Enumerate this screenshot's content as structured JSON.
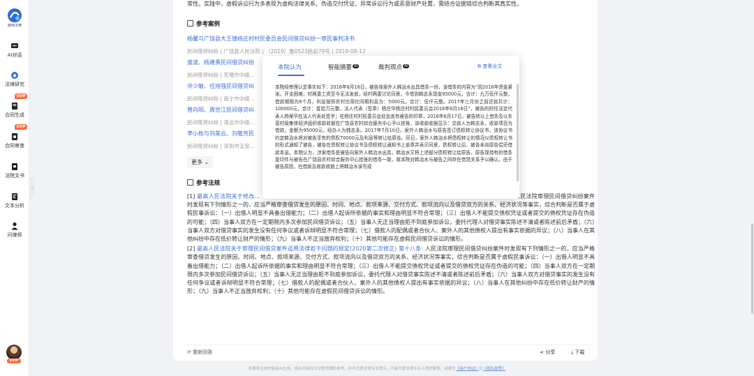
{
  "sidebar": {
    "logo_text": "麻咪法律",
    "items": [
      {
        "label": "AI对话",
        "icon": "chat-icon"
      },
      {
        "label": "法律研究",
        "icon": "research-icon"
      },
      {
        "label": "合同生成",
        "icon": "contract-generate-icon"
      },
      {
        "label": "合同审查",
        "icon": "contract-review-icon"
      },
      {
        "label": "法院文书",
        "icon": "court-document-icon"
      },
      {
        "label": "文本分析",
        "icon": "text-analysis-icon"
      },
      {
        "label": "问律师",
        "icon": "ask-lawyer-icon"
      }
    ],
    "svip_badge": "SVIP",
    "collapse": "›",
    "avatar_badge": "SVIP"
  },
  "main": {
    "top_text": "常性。实践中，虚假诉讼行为多表现为虚构法律关系、伪造交付凭证、异常诉讼行为或恶意财产处置，需结合证据链综合判断其真实性。",
    "cases_title": "参考案例",
    "cases": [
      {
        "title": "杨馨与广饶县大王镇杨庄村村民委员会民间借贷纠纷一审民事判决书",
        "meta": "民间借贷纠纷 | 广饶县人民法院 | （2019）鲁0523民初79号 | 2019-08-12"
      },
      {
        "title": "盛波、杨建勇民间借贷纠纷",
        "meta": "民间借贷纠纷 | 无锡市中级..."
      },
      {
        "title": "许少敏、任旭强民间借贷纠",
        "meta": "民间借贷纠纷 | 南宁市中级..."
      },
      {
        "title": "曾向阳、周世江民间借贷纠",
        "meta": "民间借贷纠纷 | 清远市中级..."
      },
      {
        "title": "李小枚与刘美云、刘敬芳民",
        "meta": "民间借贷纠纷 | 深圳市宝安..."
      }
    ],
    "more_label": "更多",
    "laws_title": "参考法规",
    "law1_index": "[1]",
    "law1_link": "最高人民法院关于修改",
    "law1_text_a": "...",
    "law1_right": "人民法院审理民间借贷纠纷案件时发现有下列情形之一的，应当严格审查借贷发生的原因、时间、地点、款项来源、交付方式、款项流向以及借贷双方的关系、经济状况等事实，综合判断是否属于虚假民事诉讼：（一）出借人明显不具备出借能力；（二）出借人起诉所依据的事实和理由明显不符合常理；（三）出借人不能提交债权凭证或者提交的债权凭证存在伪造的可能；（四）当事人双方在一定期限内多次参加民间借贷诉讼；（五）当事人无正当理由拒不到庭参加诉讼，委托代理人对借贷事实陈述不清或者陈述前后矛盾；（六）当事人双方对借贷事实的发生没有任何争议或者诉辩明显不符合常理；（七）借款人的配偶或者合伙人、案外人的其他债权人提出有事实依据的异议；（八）当事人在其他纠纷中存在低价转让财产的情形；（九）当事人不正当放弃权利；（十）其他可能存在虚假民间借贷诉讼的情形。",
    "law2_index": "[2]",
    "law2_link": "最高人民法院关于审理民间借贷案件适用法律若干问题的规定(2020第二次修正) 第十八条:",
    "law2_text": "人民法院审理民间借贷纠纷案件时发现有下列情形之一的，应当严格审查借贷发生的原因、时间、地点、款项来源、交付方式、款项流向以及借贷双方的关系、经济状况等事实，综合判断是否属于虚假民事诉讼：（一）出借人明显不具备出借能力；（二）出借人起诉所依据的事实和理由明显不符合常理；（三）出借人不能提交债权凭证或者提交的债权凭证存在伪造的可能；（四）当事人双方在一定期限内多次参加民间借贷诉讼；（五）当事人无正当理由拒不到庭参加诉讼，委托代理人对借贷事实陈述不清或者陈述前后矛盾；（六）当事人双方对借贷事实的发生没有任何争议或者诉辩明显不符合常理；（七）借款人的配偶或者合伙人、案外人的其他债权人提出有事实依据的异议；（八）当事人在其他纠纷中存在低价转让财产的情形；（九）当事人不正当放弃权利；（十）其他可能存在虚假民间借贷诉讼的情形。",
    "regenerate": "重新回答",
    "share": "分享",
    "download": "下载"
  },
  "disclaimer": {
    "text": "本服务生成内容由AI生成，相关内容仅为您提供辅助参考，并不代表法律专业意见，不能代替法律专业人员的解答。请遵守",
    "link1": "《用户协议》",
    "and": "及",
    "link2": "《隐私政策》"
  },
  "popup": {
    "tabs": [
      "本院认为",
      "智能摘要",
      "裁判观点"
    ],
    "ai_badge": "AI",
    "view_full": "查看全文",
    "body": "本院经审理认定事实如下：2016年8月16日，被告徐案外人韩治水出具借条一份，该借条的内容为“因2016年资金紧张，开支困难，村两委工资至今无法发放，经村两委讨论同意，今借到韩志永现金95000元，合计：九万伍仟元整，借款期限为6个月，利息按照农村信用社同期利息为：5000元，合计：伍仟元整。2017年三月份之前还款共计：100000元，合计：壹拾万元整。法人代表（签章）杨庄华杨庄村村民委员会2016年8月16日”，被告的时任法定代表人杨荣华在法人代表处签字；在杨庄村村民委员会处加盖有被告的印章，2016年8月17日，被告转以上借条及以东营村级集体经济组织收款收据在广饶县农村综合服务中心予以挂账，该收款收据显示：交款人为韩志永，收款项目为借款，金额为95000元，经办人为韩志永。2017年7月10日，案外人韩治水与原告签订债权转让协议书，该协议书约定韩治水将对被告享有的债权70000元及利息等转让给原告。同日，案外人韩治水将债权转让的情况以债权转让书的形式通知了被告，被告在债权转让协议书及债权转让通知书上盖章并表示同意，债权转让后，被告未向原告偿还借款本息。本院认为，涉案借条是被告向案外人韩治水出具，韩治水又将上述部分债权转让给原告，原告现持有的借条复印件与被告在广饶县农村综合服务中心挂账的借条一致，故本院对韩治水与被告之间存在借贷关系予以确认。由于被告原因，在借款及收款收据上将韩治水误写成"
  }
}
